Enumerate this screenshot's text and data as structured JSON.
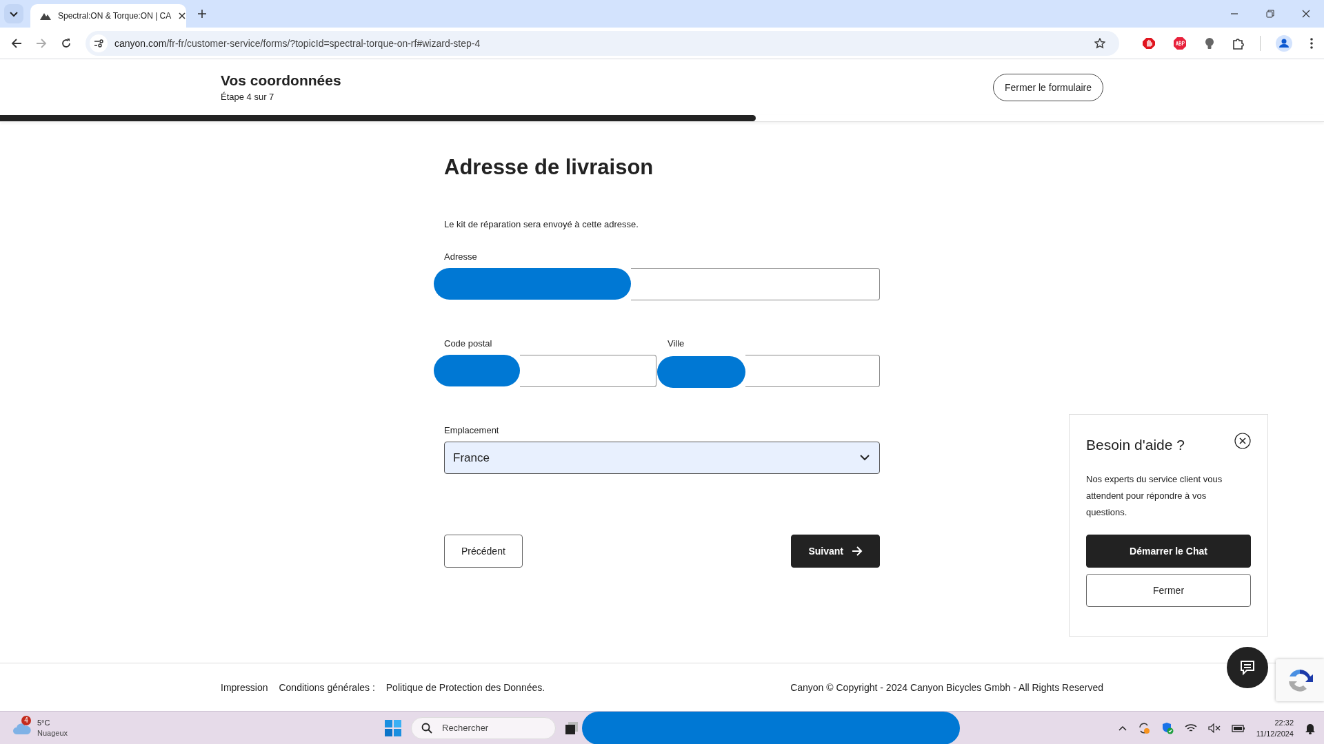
{
  "browser": {
    "tab_title": "Spectral:ON & Torque:ON | CA",
    "url_host": "canyon.com",
    "url_path": "/fr-fr/customer-service/forms/?topicId=spectral-torque-on-rf#wizard-step-4"
  },
  "header": {
    "title": "Vos coordonnées",
    "step": "Étape 4 sur 7",
    "close_button": "Fermer le formulaire",
    "progress": {
      "level": 0.571
    }
  },
  "form": {
    "heading": "Adresse de livraison",
    "intro": "Le kit de réparation sera envoyé à cette adresse.",
    "fields": [
      {
        "label": "Adresse",
        "redacted": true
      },
      {
        "label": "Code postal",
        "redacted": true
      },
      {
        "label": "Ville",
        "redacted": true
      }
    ],
    "select": {
      "label": "Emplacement",
      "value": "France"
    },
    "back_button": "Précédent",
    "next_button": "Suivant"
  },
  "help_panel": {
    "title": "Besoin d'aide ?",
    "text": "Nos experts du service client vous attendent pour répondre à vos questions.",
    "chat_button": "Démarrer le Chat",
    "close_button": "Fermer"
  },
  "footer": {
    "links": [
      "Impression",
      "Conditions générales :",
      "Politique de Protection des Données."
    ],
    "copyright": "Canyon © Copyright - 2024 Canyon Bicycles Gmbh - All Rights Reserved"
  },
  "taskbar": {
    "weather_badge": "4",
    "temperature": "5°C",
    "condition": "Nuageux",
    "search_placeholder": "Rechercher",
    "apps_redacted": true,
    "time": "22:32",
    "date": "11/12/2024"
  }
}
